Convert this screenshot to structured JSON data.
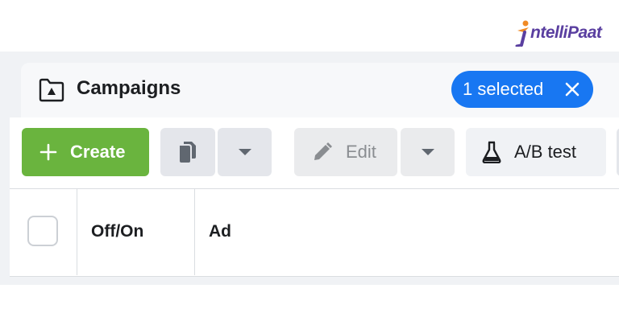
{
  "brand": {
    "logo_text": "ntelliPaat"
  },
  "header": {
    "title": "Campaigns",
    "selected_label": "1 selected"
  },
  "toolbar": {
    "create_label": "Create",
    "edit_label": "Edit",
    "ab_test_label": "A/B test"
  },
  "table": {
    "columns": [
      "Off/On",
      "Ad"
    ]
  },
  "colors": {
    "create_green": "#6ab43e",
    "selected_blue": "#1877f2",
    "logo_purple": "#5a3fa0"
  },
  "icons": [
    "folder-icon",
    "close-icon",
    "plus-icon",
    "duplicate-icon",
    "chevron-down-icon",
    "pencil-icon",
    "flask-icon"
  ]
}
